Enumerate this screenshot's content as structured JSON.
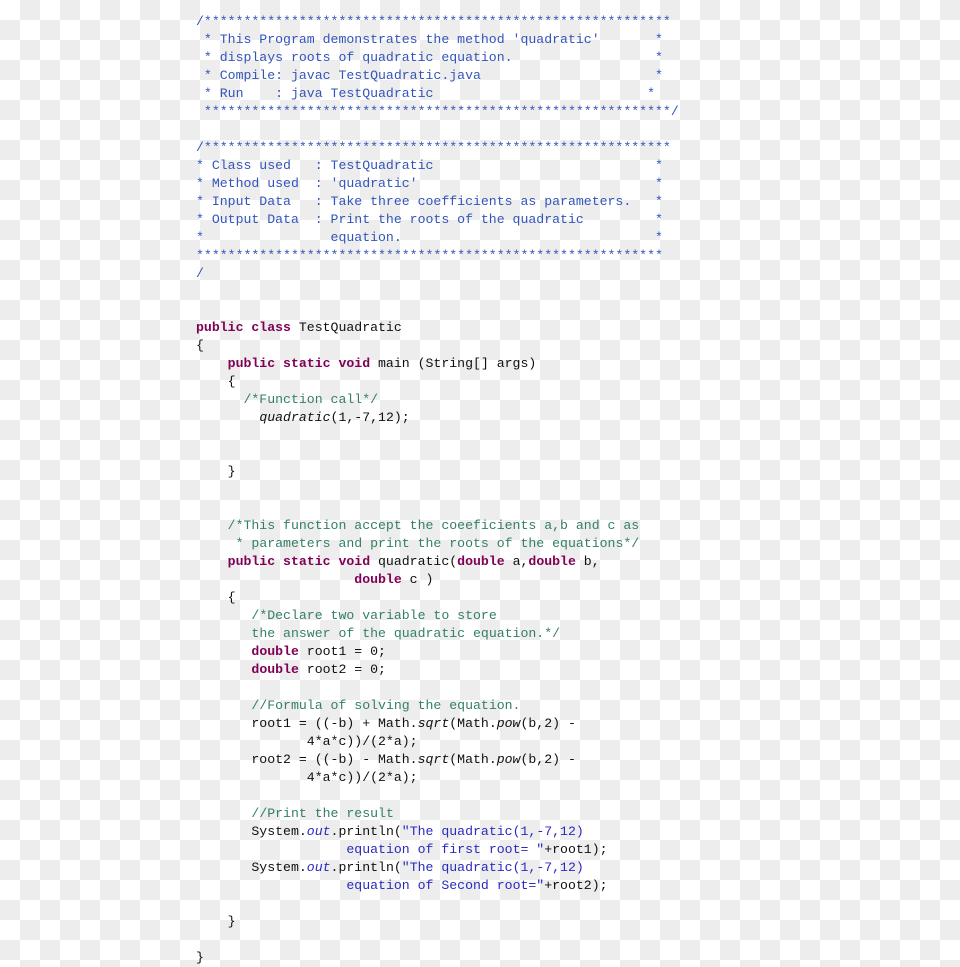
{
  "document": {
    "language": "java",
    "file_label": "TestQuadratic.java",
    "colors": {
      "background_light": "#ffffff",
      "background_checker": "#ededed",
      "block_comment": "#3355bb",
      "line_comment": "#337f63",
      "keyword": "#7f0055",
      "string": "#2a2ac0",
      "plain": "#101010"
    }
  },
  "code": {
    "lines": [
      {
        "id": "l1",
        "segments": [
          {
            "text": "/***********************************************************",
            "style": "c-doc"
          }
        ]
      },
      {
        "id": "l2",
        "segments": [
          {
            "text": " * This Program demonstrates the method 'quadratic'       *",
            "style": "c-doc"
          }
        ]
      },
      {
        "id": "l3",
        "segments": [
          {
            "text": " * displays roots of quadratic equation.                  *",
            "style": "c-doc"
          }
        ]
      },
      {
        "id": "l4",
        "segments": [
          {
            "text": " * Compile: javac TestQuadratic.java                      *",
            "style": "c-doc"
          }
        ]
      },
      {
        "id": "l5",
        "segments": [
          {
            "text": " * Run    : java TestQuadratic                           *",
            "style": "c-doc"
          }
        ]
      },
      {
        "id": "l6",
        "segments": [
          {
            "text": " ***********************************************************/",
            "style": "c-doc"
          }
        ]
      },
      {
        "id": "l7",
        "segments": [
          {
            "text": "",
            "style": "c-plain"
          }
        ]
      },
      {
        "id": "l8",
        "segments": [
          {
            "text": "/***********************************************************",
            "style": "c-doc"
          }
        ]
      },
      {
        "id": "l9",
        "segments": [
          {
            "text": "* Class used   : TestQuadratic                            *",
            "style": "c-doc"
          }
        ]
      },
      {
        "id": "l10",
        "segments": [
          {
            "text": "* Method used  : 'quadratic'                              *",
            "style": "c-doc"
          }
        ]
      },
      {
        "id": "l11",
        "segments": [
          {
            "text": "* Input Data   : Take three coefficients as parameters.   *",
            "style": "c-doc"
          }
        ]
      },
      {
        "id": "l12",
        "segments": [
          {
            "text": "* Output Data  : Print the roots of the quadratic         *",
            "style": "c-doc"
          }
        ]
      },
      {
        "id": "l13",
        "segments": [
          {
            "text": "*                equation.                                *",
            "style": "c-doc"
          }
        ]
      },
      {
        "id": "l14",
        "segments": [
          {
            "text": "***********************************************************",
            "style": "c-doc"
          }
        ]
      },
      {
        "id": "l15",
        "segments": [
          {
            "text": "/",
            "style": "c-doc"
          }
        ]
      },
      {
        "id": "l16",
        "segments": [
          {
            "text": "",
            "style": "c-plain"
          }
        ]
      },
      {
        "id": "l17",
        "segments": [
          {
            "text": "",
            "style": "c-plain"
          }
        ]
      },
      {
        "id": "l18",
        "segments": [
          {
            "text": "public class",
            "style": "c-kw"
          },
          {
            "text": " TestQuadratic",
            "style": "c-plain"
          }
        ]
      },
      {
        "id": "l19",
        "segments": [
          {
            "text": "{",
            "style": "c-plain"
          }
        ]
      },
      {
        "id": "l20",
        "segments": [
          {
            "text": "    ",
            "style": "c-plain"
          },
          {
            "text": "public static void",
            "style": "c-kw"
          },
          {
            "text": " main (String[] args)",
            "style": "c-plain"
          }
        ]
      },
      {
        "id": "l21",
        "segments": [
          {
            "text": "    {",
            "style": "c-plain"
          }
        ]
      },
      {
        "id": "l22",
        "segments": [
          {
            "text": "      ",
            "style": "c-plain"
          },
          {
            "text": "/*Function call*/",
            "style": "c-cmt"
          }
        ]
      },
      {
        "id": "l23",
        "segments": [
          {
            "text": "        ",
            "style": "c-plain"
          },
          {
            "text": "quadratic",
            "style": "c-plain c-it"
          },
          {
            "text": "(1,-7,12);",
            "style": "c-plain"
          }
        ]
      },
      {
        "id": "l24",
        "segments": [
          {
            "text": "",
            "style": "c-plain"
          }
        ]
      },
      {
        "id": "l25",
        "segments": [
          {
            "text": "",
            "style": "c-plain"
          }
        ]
      },
      {
        "id": "l26",
        "segments": [
          {
            "text": "    }",
            "style": "c-plain"
          }
        ]
      },
      {
        "id": "l27",
        "segments": [
          {
            "text": "",
            "style": "c-plain"
          }
        ]
      },
      {
        "id": "l28",
        "segments": [
          {
            "text": "",
            "style": "c-plain"
          }
        ]
      },
      {
        "id": "l29",
        "segments": [
          {
            "text": "    ",
            "style": "c-plain"
          },
          {
            "text": "/*This function accept the coeeficients a,b and c as",
            "style": "c-cmt"
          }
        ]
      },
      {
        "id": "l30",
        "segments": [
          {
            "text": "     ",
            "style": "c-plain"
          },
          {
            "text": "* parameters and print the roots of the equations*/",
            "style": "c-cmt"
          }
        ]
      },
      {
        "id": "l31",
        "segments": [
          {
            "text": "    ",
            "style": "c-plain"
          },
          {
            "text": "public static void",
            "style": "c-kw"
          },
          {
            "text": " quadratic(",
            "style": "c-plain"
          },
          {
            "text": "double",
            "style": "c-kw"
          },
          {
            "text": " a,",
            "style": "c-plain"
          },
          {
            "text": "double",
            "style": "c-kw"
          },
          {
            "text": " b,",
            "style": "c-plain"
          }
        ]
      },
      {
        "id": "l32",
        "segments": [
          {
            "text": "                    ",
            "style": "c-plain"
          },
          {
            "text": "double",
            "style": "c-kw"
          },
          {
            "text": " c )",
            "style": "c-plain"
          }
        ]
      },
      {
        "id": "l33",
        "segments": [
          {
            "text": "    {",
            "style": "c-plain"
          }
        ]
      },
      {
        "id": "l34",
        "segments": [
          {
            "text": "       ",
            "style": "c-plain"
          },
          {
            "text": "/*Declare two variable to store",
            "style": "c-cmt"
          }
        ]
      },
      {
        "id": "l35",
        "segments": [
          {
            "text": "       ",
            "style": "c-plain"
          },
          {
            "text": "the answer of the quadratic equation.*/",
            "style": "c-cmt"
          }
        ]
      },
      {
        "id": "l36",
        "segments": [
          {
            "text": "       ",
            "style": "c-plain"
          },
          {
            "text": "double",
            "style": "c-kw"
          },
          {
            "text": " root1 = 0;",
            "style": "c-plain"
          }
        ]
      },
      {
        "id": "l37",
        "segments": [
          {
            "text": "       ",
            "style": "c-plain"
          },
          {
            "text": "double",
            "style": "c-kw"
          },
          {
            "text": " root2 = 0;",
            "style": "c-plain"
          }
        ]
      },
      {
        "id": "l38",
        "segments": [
          {
            "text": "",
            "style": "c-plain"
          }
        ]
      },
      {
        "id": "l39",
        "segments": [
          {
            "text": "       ",
            "style": "c-plain"
          },
          {
            "text": "//Formula of solving the equation.",
            "style": "c-cmt"
          }
        ]
      },
      {
        "id": "l40",
        "segments": [
          {
            "text": "       root1 = ((-b) + Math.",
            "style": "c-plain"
          },
          {
            "text": "sqrt",
            "style": "c-plain c-it"
          },
          {
            "text": "(Math.",
            "style": "c-plain"
          },
          {
            "text": "pow",
            "style": "c-plain c-it"
          },
          {
            "text": "(b,2) -",
            "style": "c-plain"
          }
        ]
      },
      {
        "id": "l41",
        "segments": [
          {
            "text": "              4*a*c))/(2*a);",
            "style": "c-plain"
          }
        ]
      },
      {
        "id": "l42",
        "segments": [
          {
            "text": "       root2 = ((-b) - Math.",
            "style": "c-plain"
          },
          {
            "text": "sqrt",
            "style": "c-plain c-it"
          },
          {
            "text": "(Math.",
            "style": "c-plain"
          },
          {
            "text": "pow",
            "style": "c-plain c-it"
          },
          {
            "text": "(b,2) -",
            "style": "c-plain"
          }
        ]
      },
      {
        "id": "l43",
        "segments": [
          {
            "text": "              4*a*c))/(2*a);",
            "style": "c-plain"
          }
        ]
      },
      {
        "id": "l44",
        "segments": [
          {
            "text": "",
            "style": "c-plain"
          }
        ]
      },
      {
        "id": "l45",
        "segments": [
          {
            "text": "       ",
            "style": "c-plain"
          },
          {
            "text": "//Print the result",
            "style": "c-cmt"
          }
        ]
      },
      {
        "id": "l46",
        "segments": [
          {
            "text": "       System.",
            "style": "c-plain"
          },
          {
            "text": "out",
            "style": "c-str c-it"
          },
          {
            "text": ".println(",
            "style": "c-plain"
          },
          {
            "text": "\"The quadratic(1,-7,12)",
            "style": "c-str"
          }
        ]
      },
      {
        "id": "l47",
        "segments": [
          {
            "text": "                   ",
            "style": "c-plain"
          },
          {
            "text": "equation of first root= \"",
            "style": "c-str"
          },
          {
            "text": "+root1);",
            "style": "c-plain"
          }
        ]
      },
      {
        "id": "l48",
        "segments": [
          {
            "text": "       System.",
            "style": "c-plain"
          },
          {
            "text": "out",
            "style": "c-str c-it"
          },
          {
            "text": ".println(",
            "style": "c-plain"
          },
          {
            "text": "\"The quadratic(1,-7,12)",
            "style": "c-str"
          }
        ]
      },
      {
        "id": "l49",
        "segments": [
          {
            "text": "                   ",
            "style": "c-plain"
          },
          {
            "text": "equation of Second root=\"",
            "style": "c-str"
          },
          {
            "text": "+root2);",
            "style": "c-plain"
          }
        ]
      },
      {
        "id": "l50",
        "segments": [
          {
            "text": "",
            "style": "c-plain"
          }
        ]
      },
      {
        "id": "l51",
        "segments": [
          {
            "text": "    }",
            "style": "c-plain"
          }
        ]
      },
      {
        "id": "l52",
        "segments": [
          {
            "text": "",
            "style": "c-plain"
          }
        ]
      },
      {
        "id": "l53",
        "segments": [
          {
            "text": "}",
            "style": "c-plain"
          }
        ]
      }
    ]
  }
}
